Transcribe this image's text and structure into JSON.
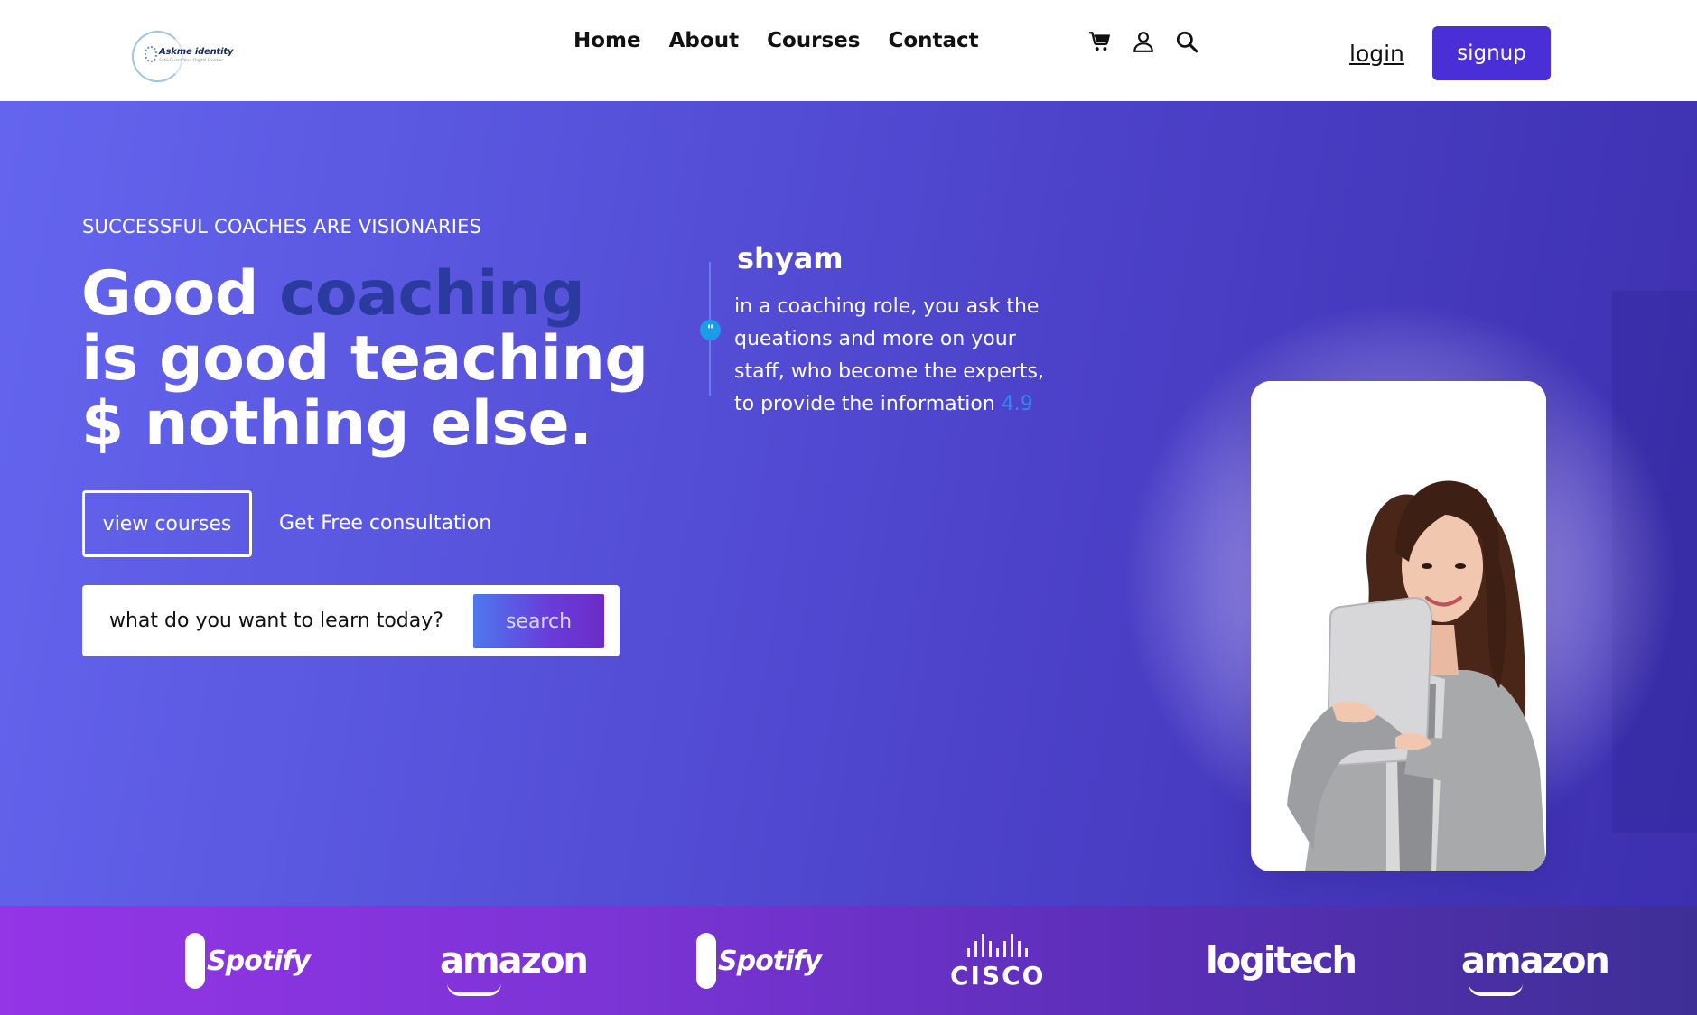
{
  "header": {
    "logo": {
      "name": "Askme identity",
      "tagline": "Safe-Guard Your Digital Frontier"
    },
    "nav": [
      {
        "label": "Home"
      },
      {
        "label": "About"
      },
      {
        "label": "Courses"
      },
      {
        "label": "Contact"
      }
    ],
    "icons": [
      "cart-icon",
      "user-icon",
      "search-icon"
    ],
    "login_label": "login",
    "signup_label": "signup"
  },
  "hero": {
    "tagline": "SUCCESSFUL COACHES ARE VISIONARIES",
    "headline": {
      "part1": "Good ",
      "accent": "coaching",
      "part2": " is good teaching $ nothing else."
    },
    "view_courses_label": "view courses",
    "consult_label": "Get Free consultation",
    "search": {
      "value": "what do you want to learn today?",
      "button_label": "search"
    },
    "testimonial": {
      "name": "shyam",
      "text": "in a coaching role, you ask the queations and more on your staff, who become the experts, to provide the information",
      "rating": "4.9"
    }
  },
  "brands": [
    {
      "name": "Spotify"
    },
    {
      "name": "amazon"
    },
    {
      "name": "Spotify"
    },
    {
      "name": "CISCO"
    },
    {
      "name": "logitech"
    },
    {
      "name": "amazon"
    }
  ],
  "colors": {
    "primary": "#4a2fd6",
    "hero_start": "#6465ef",
    "hero_end": "#3d2fae",
    "headline_accent": "#2a3a9e",
    "rating": "#2f86f5",
    "strip_start": "#9435e6",
    "strip_end": "#3e2f96"
  }
}
